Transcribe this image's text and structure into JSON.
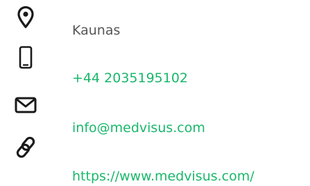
{
  "contact": {
    "location": {
      "icon": "location-pin-icon",
      "text": "Kaunas"
    },
    "phone": {
      "icon": "mobile-phone-icon",
      "text": "+44 2035195102"
    },
    "email": {
      "icon": "envelope-icon",
      "text": "info@medvisus.com"
    },
    "website": {
      "icon": "link-icon",
      "text": "https://www.medvisus.com/"
    }
  },
  "colors": {
    "link": "#1ab76b",
    "text": "#555555",
    "icon": "#1a1a1a"
  }
}
